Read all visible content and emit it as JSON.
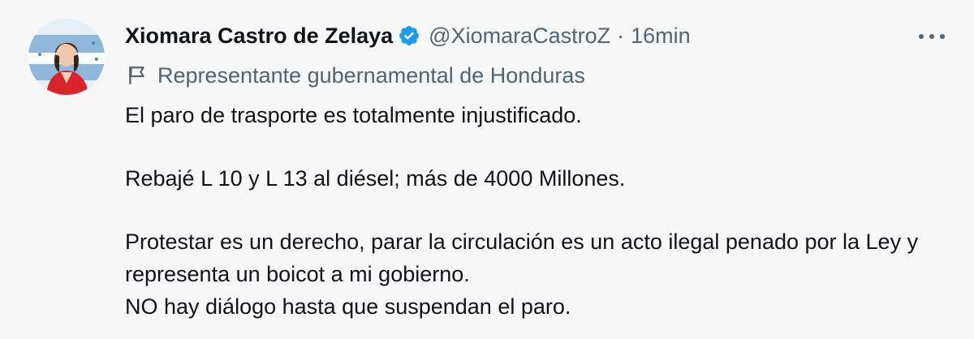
{
  "author": {
    "name": "Xiomara Castro de Zelaya",
    "handle": "@XiomaraCastroZ",
    "separator": "·",
    "time": "16min"
  },
  "account_label": "Representante gubernamental de Honduras",
  "tweet": {
    "line1": "El paro de trasporte es totalmente injustificado.",
    "line2": "Rebajé L 10 y L 13 al diésel; más de 4000 Millones.",
    "line3": "Protestar es un derecho, parar la circulación es un acto ilegal penado por la Ley y representa un boicot a mi gobierno.",
    "line4": "NO hay diálogo hasta que suspendan el paro."
  },
  "icons": {
    "verified": "verified-badge-icon",
    "more": "more-options-icon",
    "flag": "government-flag-icon"
  },
  "colors": {
    "background": "#f7f7f7",
    "text": "#0f1419",
    "secondary": "#536471",
    "verified": "#1d9bf0",
    "avatar_red": "#d8232a"
  }
}
